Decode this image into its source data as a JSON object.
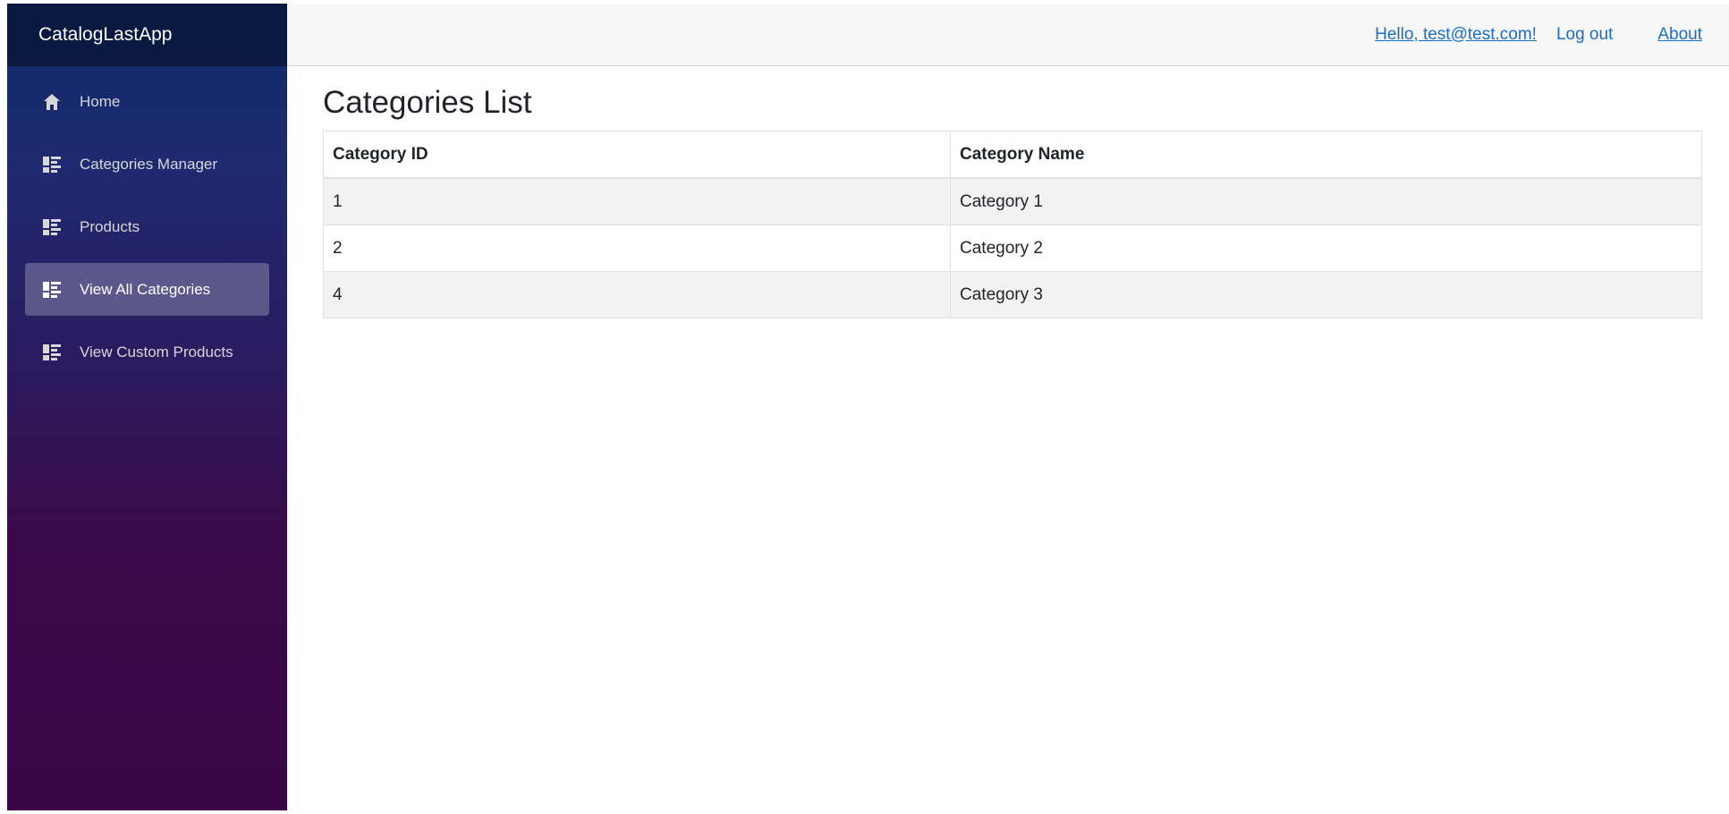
{
  "app": {
    "brand": "CatalogLastApp"
  },
  "sidebar": {
    "items": [
      {
        "label": "Home",
        "icon": "home-icon",
        "active": false
      },
      {
        "label": "Categories Manager",
        "icon": "list-icon",
        "active": false
      },
      {
        "label": "Products",
        "icon": "list-icon",
        "active": false
      },
      {
        "label": "View All Categories",
        "icon": "list-icon",
        "active": true
      },
      {
        "label": "View Custom Products",
        "icon": "list-icon",
        "active": false
      }
    ]
  },
  "header": {
    "greeting": "Hello, test@test.com!",
    "logout": "Log out",
    "about": "About"
  },
  "page": {
    "title": "Categories List",
    "columns": [
      "Category ID",
      "Category Name"
    ],
    "rows": [
      [
        "1",
        "Category 1"
      ],
      [
        "2",
        "Category 2"
      ],
      [
        "4",
        "Category 3"
      ]
    ]
  },
  "colors": {
    "accent_link": "#1b6ec2",
    "sidebar_top": "#0d2a6b",
    "sidebar_bottom": "#3a0646"
  }
}
